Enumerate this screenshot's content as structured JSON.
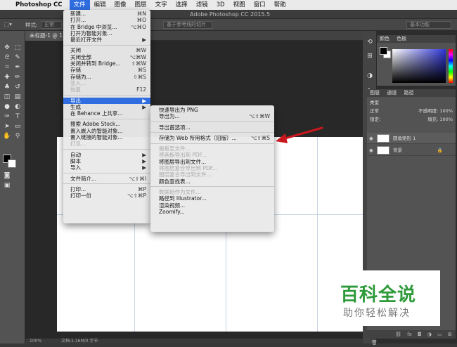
{
  "menubar": {
    "app_name": "Photoshop CC",
    "items": [
      "文件",
      "编辑",
      "图像",
      "图层",
      "文字",
      "选择",
      "滤镜",
      "3D",
      "视图",
      "窗口",
      "帮助"
    ]
  },
  "window": {
    "title": "Adobe Photoshop CC 2015.5"
  },
  "options_bar": {
    "style_label": "样式:",
    "style_value": "正常",
    "guide_button": "基于参考线的切片",
    "workspace": "基本功能"
  },
  "document_tab": {
    "label": "未标题-1 @ 1"
  },
  "file_menu": {
    "groups": [
      [
        {
          "label": "新建...",
          "shortcut": "⌘N",
          "disabled": false
        },
        {
          "label": "打开...",
          "shortcut": "⌘O",
          "disabled": false
        },
        {
          "label": "在 Bridge 中浏览...",
          "shortcut": "⌥⌘O",
          "disabled": false
        },
        {
          "label": "打开为智能对象...",
          "shortcut": "",
          "disabled": false
        },
        {
          "label": "最近打开文件",
          "shortcut": "▶",
          "disabled": false
        }
      ],
      [
        {
          "label": "关闭",
          "shortcut": "⌘W",
          "disabled": false
        },
        {
          "label": "关闭全部",
          "shortcut": "⌥⌘W",
          "disabled": false
        },
        {
          "label": "关闭并转到 Bridge...",
          "shortcut": "⇧⌘W",
          "disabled": false
        },
        {
          "label": "存储",
          "shortcut": "⌘S",
          "disabled": false
        },
        {
          "label": "存储为...",
          "shortcut": "⇧⌘S",
          "disabled": false
        },
        {
          "label": "签入...",
          "shortcut": "",
          "disabled": true
        },
        {
          "label": "恢复",
          "shortcut": "F12",
          "disabled": true
        }
      ],
      [
        {
          "label": "导出",
          "shortcut": "▶",
          "disabled": false,
          "highlighted": true
        },
        {
          "label": "生成",
          "shortcut": "▶",
          "disabled": false
        },
        {
          "label": "在 Behance 上共享...",
          "shortcut": "",
          "disabled": false
        }
      ],
      [
        {
          "label": "搜索 Adobe Stock...",
          "shortcut": "",
          "disabled": false
        },
        {
          "label": "置入嵌入的智能对象...",
          "shortcut": "",
          "disabled": false
        },
        {
          "label": "置入链接的智能对象...",
          "shortcut": "",
          "disabled": false
        },
        {
          "label": "打包...",
          "shortcut": "",
          "disabled": true
        }
      ],
      [
        {
          "label": "自动",
          "shortcut": "▶",
          "disabled": false
        },
        {
          "label": "脚本",
          "shortcut": "▶",
          "disabled": false
        },
        {
          "label": "导入",
          "shortcut": "▶",
          "disabled": false
        }
      ],
      [
        {
          "label": "文件简介...",
          "shortcut": "⌥⇧⌘I",
          "disabled": false
        }
      ],
      [
        {
          "label": "打印...",
          "shortcut": "⌘P",
          "disabled": false
        },
        {
          "label": "打印一份",
          "shortcut": "⌥⇧⌘P",
          "disabled": false
        }
      ]
    ]
  },
  "export_menu": {
    "groups": [
      [
        {
          "label": "快速导出为 PNG",
          "shortcut": "",
          "disabled": false
        },
        {
          "label": "导出为...",
          "shortcut": "⌥⇧⌘W",
          "disabled": false
        }
      ],
      [
        {
          "label": "导出首选项...",
          "shortcut": "",
          "disabled": false
        }
      ],
      [
        {
          "label": "存储为 Web 所用格式（旧版）...",
          "shortcut": "⌥⇧⌘S",
          "disabled": false
        }
      ],
      [
        {
          "label": "画板至文件...",
          "shortcut": "",
          "disabled": true
        },
        {
          "label": "将画板导出到 PDF...",
          "shortcut": "",
          "disabled": true
        },
        {
          "label": "将图层导出到文件...",
          "shortcut": "",
          "disabled": false
        },
        {
          "label": "将图层复合导出到 PDF...",
          "shortcut": "",
          "disabled": true
        },
        {
          "label": "图层复合导出到文件...",
          "shortcut": "",
          "disabled": true
        },
        {
          "label": "颜色查找表...",
          "shortcut": "",
          "disabled": false
        }
      ],
      [
        {
          "label": "数据组作为文件...",
          "shortcut": "",
          "disabled": true
        },
        {
          "label": "路径到 Illustrator...",
          "shortcut": "",
          "disabled": false
        },
        {
          "label": "渲染视频...",
          "shortcut": "",
          "disabled": false
        },
        {
          "label": "Zoomify...",
          "shortcut": "",
          "disabled": false
        }
      ]
    ]
  },
  "color_panel": {
    "tabs": [
      "颜色",
      "色板"
    ]
  },
  "layers_panel": {
    "tabs": [
      "图层",
      "通道",
      "路径"
    ],
    "filter_label": "类型",
    "blend_mode": "正常",
    "opacity_label": "不透明度: 100%",
    "lock_label": "锁定:",
    "fill_label": "填充: 100%",
    "layers": [
      {
        "name": "圆角矩形 1",
        "locked": false
      },
      {
        "name": "背景",
        "locked": true
      }
    ]
  },
  "status": {
    "zoom": "100%",
    "doc": "文档:1.16M/0 字节"
  },
  "watermark": {
    "title": "百科全说",
    "subtitle": "助你轻松解决"
  },
  "colors": {
    "accent": "#2f6de1",
    "arrow": "#c8181e",
    "watermark_green": "#2e9a3a"
  }
}
